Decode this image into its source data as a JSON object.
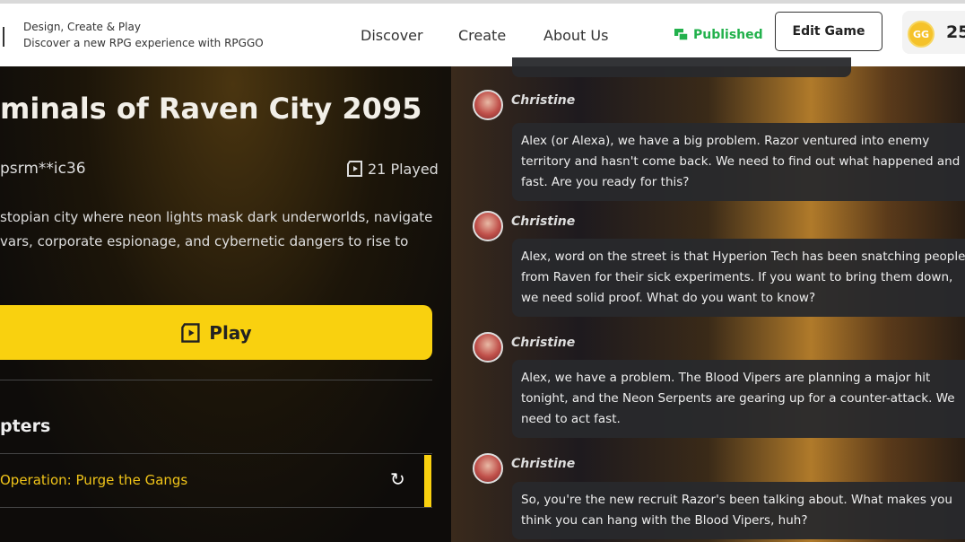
{
  "header": {
    "tagline": "Design, Create & Play",
    "subtagline": "Discover a new RPG experience with RPGGO",
    "nav": [
      "Discover",
      "Create",
      "About Us"
    ],
    "status": "Published",
    "edit_label": "Edit Game",
    "coin_logo": "GG",
    "coins": "25"
  },
  "game": {
    "title": "minals of Raven City 2095",
    "author": "psrm**ic36",
    "played": "21 Played",
    "description": [
      "stopian city where neon lights mask dark underworlds, navigate",
      "vars, corporate espionage, and cybernetic dangers to rise to"
    ],
    "play_label": "Play",
    "chapters_heading": "pters",
    "chapters": [
      {
        "name": "Operation: Purge the Gangs"
      }
    ]
  },
  "chat": {
    "messages": [
      {
        "name": "Christine",
        "text": "Alex (or Alexa), we have a big problem. Razor ventured into enemy territory and hasn't come back. We need to find out what happened and fast. Are you ready for this?"
      },
      {
        "name": "Christine",
        "text": "Alex, word on the street is that Hyperion Tech has been snatching people from Raven for their sick experiments. If you want to bring them down, we need solid proof. What do you want to know?"
      },
      {
        "name": "Christine",
        "text": "Alex, we have a problem. The Blood Vipers are planning a major hit tonight, and the Neon Serpents are gearing up for a counter-attack. We need to act fast."
      },
      {
        "name": "Christine",
        "text": "So, you're the new recruit Razor's been talking about. What makes you think you can hang with the Blood Vipers, huh?"
      }
    ]
  }
}
